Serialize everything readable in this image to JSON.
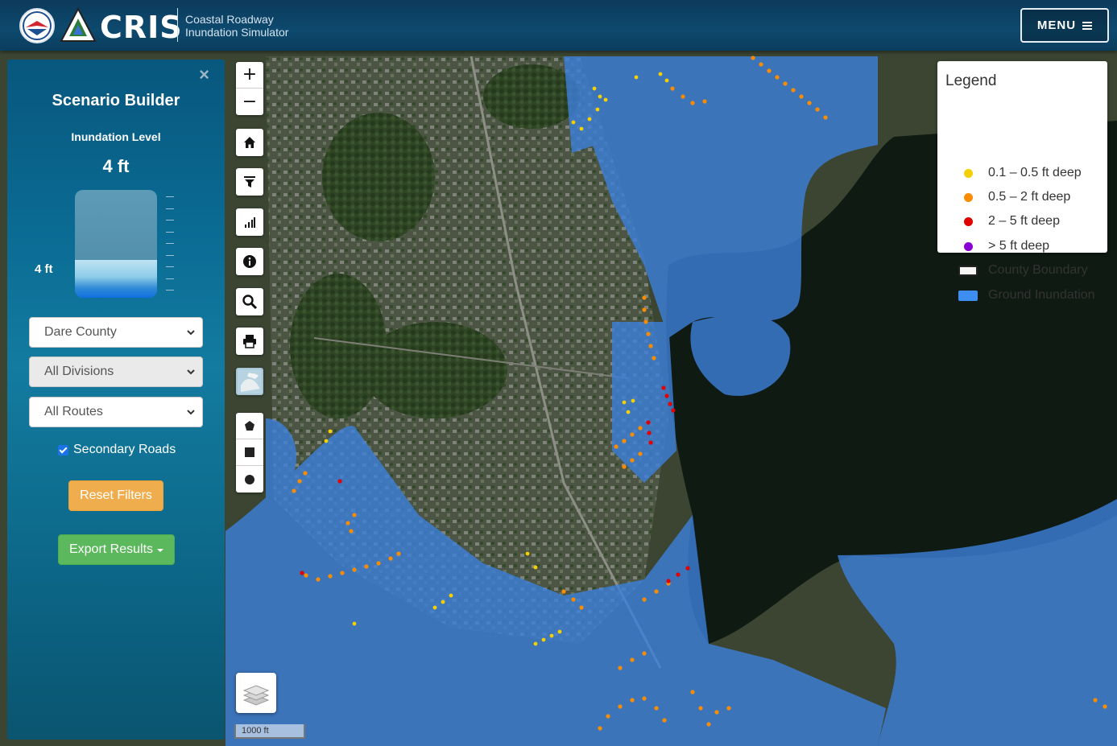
{
  "header": {
    "brand": "CRIS",
    "subtitle_line1": "Coastal Roadway",
    "subtitle_line2": "Inundation Simulator",
    "menu_label": "MENU"
  },
  "panel": {
    "title": "Scenario Builder",
    "inundation_label": "Inundation Level",
    "inundation_value": "4 ft",
    "gauge_marker": "4 ft",
    "gauge_fill_fraction": 0.35,
    "county_select": "Dare County",
    "division_select": "All Divisions",
    "route_select": "All Routes",
    "secondary_roads_label": "Secondary Roads",
    "secondary_roads_checked": true,
    "reset_label": "Reset Filters",
    "export_label": "Export Results"
  },
  "legend": {
    "title": "Legend",
    "items": [
      {
        "label": "0.1 – 0.5 ft deep",
        "color": "#f5d000",
        "icon": "yellow-dot"
      },
      {
        "label": "0.5 – 2 ft deep",
        "color": "#fb8c00",
        "icon": "orange-dot"
      },
      {
        "label": "2 – 5 ft deep",
        "color": "#e00000",
        "icon": "red-dot"
      },
      {
        "label": "> 5 ft deep",
        "color": "#8a00d4",
        "icon": "purple-dot"
      },
      {
        "label": "County Boundary",
        "color": "#222222",
        "icon": "county-boundary-box"
      },
      {
        "label": "Ground Inundation",
        "color": "#3d8ef0",
        "icon": "ground-inundation-box"
      }
    ]
  },
  "map": {
    "scale_label": "1000 ft",
    "tools": [
      "zoom-in",
      "zoom-out",
      "home",
      "filter",
      "chart",
      "info",
      "search",
      "print",
      "basemap",
      "draw-polygon",
      "draw-rectangle",
      "draw-circle",
      "layers"
    ]
  },
  "colors": {
    "inundation": "#3d8ef0",
    "water": "#0e1a14",
    "land": "#3f4a30"
  }
}
